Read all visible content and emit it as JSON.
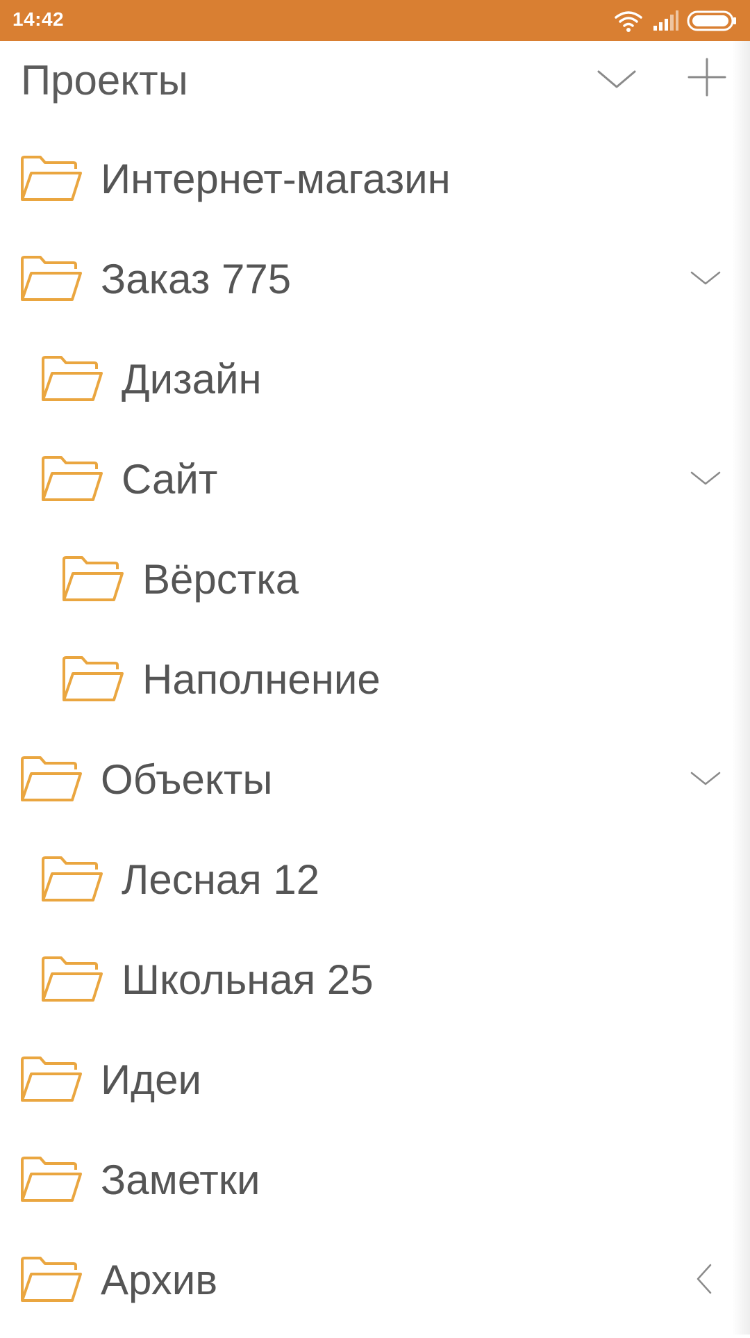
{
  "status_bar": {
    "time": "14:42",
    "icons": [
      "wifi-icon",
      "signal-icon",
      "battery-icon"
    ]
  },
  "header": {
    "title": "Проекты",
    "collapse_icon": "chevron-down-icon",
    "add_icon": "plus-icon"
  },
  "colors": {
    "status_bar": "#d97f32",
    "folder_icon": "#eaa640",
    "text": "#555555",
    "chevron": "#8a8a8a"
  },
  "folders": [
    {
      "label": "Интернет-магазин",
      "level": 0,
      "chevron": "none"
    },
    {
      "label": "Заказ 775",
      "level": 0,
      "chevron": "chevron-down-icon"
    },
    {
      "label": "Дизайн",
      "level": 1,
      "chevron": "none"
    },
    {
      "label": "Сайт",
      "level": 1,
      "chevron": "chevron-down-icon"
    },
    {
      "label": "Вёрстка",
      "level": 2,
      "chevron": "none"
    },
    {
      "label": "Наполнение",
      "level": 2,
      "chevron": "none"
    },
    {
      "label": "Объекты",
      "level": 0,
      "chevron": "chevron-down-icon"
    },
    {
      "label": "Лесная 12",
      "level": 1,
      "chevron": "none"
    },
    {
      "label": "Школьная 25",
      "level": 1,
      "chevron": "none"
    },
    {
      "label": "Идеи",
      "level": 0,
      "chevron": "none"
    },
    {
      "label": "Заметки",
      "level": 0,
      "chevron": "none"
    },
    {
      "label": "Архив",
      "level": 0,
      "chevron": "chevron-left-icon"
    }
  ]
}
